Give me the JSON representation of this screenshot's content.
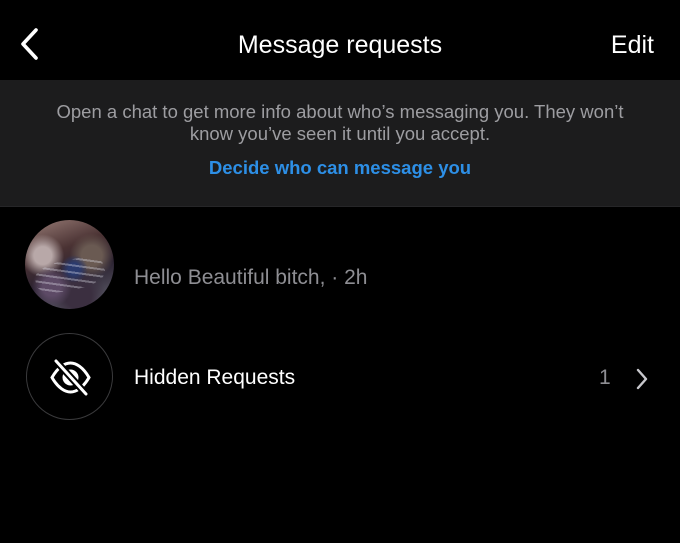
{
  "header": {
    "back_icon": "chevron-left-icon",
    "title": "Message requests",
    "edit_label": "Edit"
  },
  "info_banner": {
    "text": "Open a chat to get more info about who’s messaging you. They won’t know you’ve seen it until you accept.",
    "link_label": "Decide who can message you",
    "link_color": "#2d8fe6"
  },
  "requests": [
    {
      "preview": "Hello Beautiful bitch, · 2h"
    }
  ],
  "hidden_requests": {
    "icon": "eye-slash-icon",
    "label": "Hidden Requests",
    "count": "1",
    "chevron_icon": "chevron-right-icon"
  },
  "colors": {
    "background": "#000000",
    "banner": "#1c1c1d",
    "secondary_text": "#8e8e93"
  }
}
